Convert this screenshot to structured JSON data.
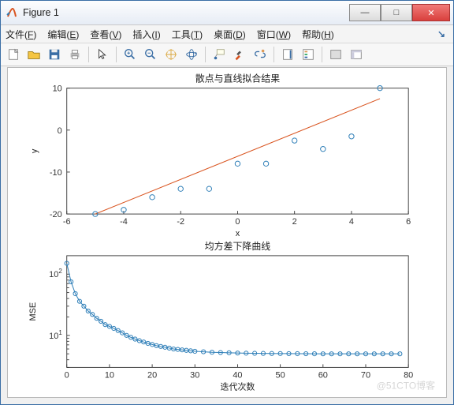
{
  "window": {
    "title": "Figure 1"
  },
  "menubar": {
    "items": [
      {
        "label": "文件",
        "accel": "F"
      },
      {
        "label": "编辑",
        "accel": "E"
      },
      {
        "label": "查看",
        "accel": "V"
      },
      {
        "label": "插入",
        "accel": "I"
      },
      {
        "label": "工具",
        "accel": "T"
      },
      {
        "label": "桌面",
        "accel": "D"
      },
      {
        "label": "窗口",
        "accel": "W"
      },
      {
        "label": "帮助",
        "accel": "H"
      }
    ]
  },
  "toolbar": {
    "groups": [
      [
        "new-figure-icon",
        "open-icon",
        "save-icon",
        "print-icon"
      ],
      [
        "pointer-icon"
      ],
      [
        "zoom-in-icon",
        "zoom-out-icon",
        "pan-icon",
        "rotate3d-icon"
      ],
      [
        "datatip-icon",
        "brush-icon",
        "link-icon"
      ],
      [
        "colorbar-icon",
        "legend-icon"
      ],
      [
        "hide-tools-icon",
        "show-tools-icon"
      ]
    ]
  },
  "watermark": "@51CTO博客",
  "chart_data": [
    {
      "type": "scatter+line",
      "title": "散点与直线拟合结果",
      "xlabel": "x",
      "ylabel": "y",
      "xlim": [
        -6,
        6
      ],
      "ylim": [
        -20,
        10
      ],
      "xticks": [
        -6,
        -4,
        -2,
        0,
        2,
        4,
        6
      ],
      "yticks": [
        -20,
        -10,
        0,
        10
      ],
      "series": [
        {
          "name": "scatter",
          "type": "scatter",
          "x": [
            -5,
            -4,
            -3,
            -2,
            -1,
            0,
            1,
            2,
            3,
            4,
            5
          ],
          "y": [
            -20,
            -19,
            -16,
            -14,
            -14,
            -8,
            -8,
            -2.5,
            -4.5,
            -1.5,
            10
          ]
        },
        {
          "name": "fit",
          "type": "line",
          "x": [
            -5,
            5
          ],
          "y": [
            -20,
            7.5
          ]
        }
      ]
    },
    {
      "type": "line",
      "title": "均方差下降曲线",
      "xlabel": "迭代次数",
      "ylabel": "MSE",
      "xlim": [
        0,
        80
      ],
      "ylim": [
        3,
        200
      ],
      "yscale": "log",
      "xticks": [
        0,
        10,
        20,
        30,
        40,
        50,
        60,
        70,
        80
      ],
      "yticks": [
        10,
        100
      ],
      "ytick_labels": [
        "10^1",
        "10^2"
      ],
      "series": [
        {
          "name": "mse",
          "type": "line-marker",
          "x": [
            0,
            1,
            2,
            3,
            4,
            5,
            6,
            7,
            8,
            9,
            10,
            11,
            12,
            13,
            14,
            15,
            16,
            17,
            18,
            19,
            20,
            21,
            22,
            23,
            24,
            25,
            26,
            27,
            28,
            29,
            30,
            32,
            34,
            36,
            38,
            40,
            42,
            44,
            46,
            48,
            50,
            52,
            54,
            56,
            58,
            60,
            62,
            64,
            66,
            68,
            70,
            72,
            74,
            76,
            78
          ],
          "y": [
            150,
            75,
            48,
            36,
            30,
            25,
            22,
            19,
            17,
            15,
            14,
            13,
            12,
            11,
            10,
            9.3,
            8.7,
            8.2,
            7.8,
            7.4,
            7.1,
            6.8,
            6.6,
            6.4,
            6.2,
            6.0,
            5.9,
            5.8,
            5.7,
            5.6,
            5.5,
            5.4,
            5.3,
            5.25,
            5.2,
            5.15,
            5.12,
            5.1,
            5.08,
            5.06,
            5.05,
            5.04,
            5.03,
            5.02,
            5.01,
            5.0,
            5.0,
            5.0,
            5.0,
            5.0,
            5.0,
            5.0,
            5.0,
            5.0,
            5.0
          ]
        }
      ]
    }
  ]
}
